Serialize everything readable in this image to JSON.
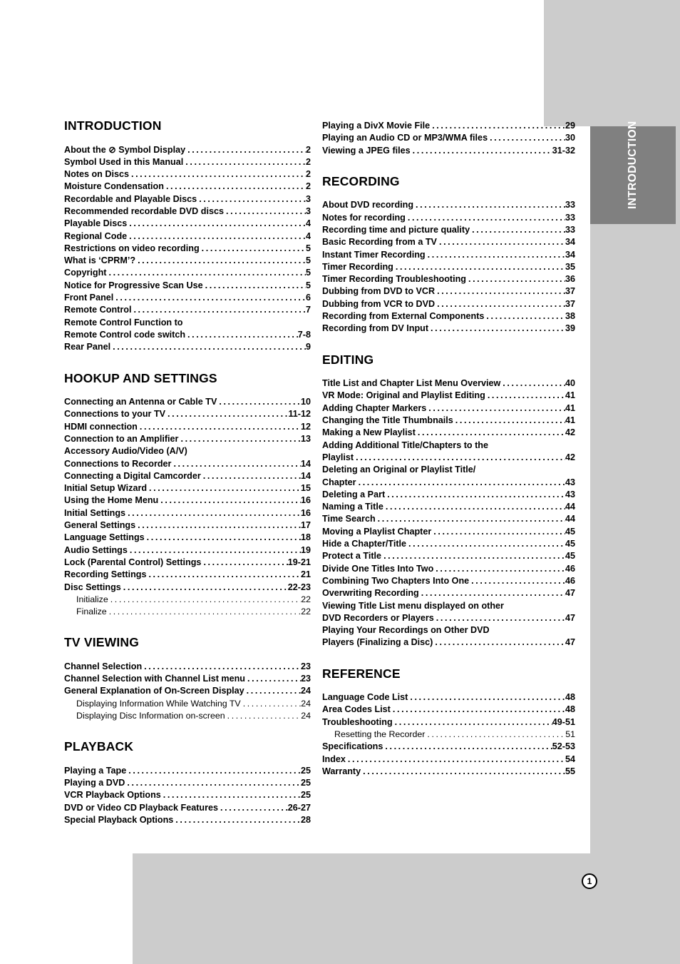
{
  "side_tab": {
    "label": "INTRODUCTION"
  },
  "page_number": "1",
  "columns": {
    "left": [
      {
        "title": "INTRODUCTION",
        "entries": [
          {
            "title": "About the ⊘ Symbol Display",
            "page": "2",
            "level": 1
          },
          {
            "title": "Symbol Used in this Manual",
            "page": "2",
            "level": 1
          },
          {
            "title": "Notes on Discs",
            "page": "2",
            "level": 1
          },
          {
            "title": "Moisture Condensation",
            "page": "2",
            "level": 1
          },
          {
            "title": "Recordable and Playable Discs",
            "page": "3",
            "level": 1
          },
          {
            "title": "Recommended recordable DVD discs",
            "page": "3",
            "level": 1
          },
          {
            "title": "Playable Discs",
            "page": "4",
            "level": 1
          },
          {
            "title": "Regional Code",
            "page": "4",
            "level": 1
          },
          {
            "title": "Restrictions on video recording",
            "page": "5",
            "level": 1
          },
          {
            "title": "What is ‘CPRM’?",
            "page": "5",
            "level": 1
          },
          {
            "title": "Copyright",
            "page": "5",
            "level": 1
          },
          {
            "title": "Notice for Progressive Scan Use",
            "page": "5",
            "level": 1
          },
          {
            "title": "Front Panel",
            "page": "6",
            "level": 1
          },
          {
            "title": "Remote Control",
            "page": "7",
            "level": 1
          },
          {
            "title": "Remote Control Function to",
            "page": "",
            "level": 1,
            "nopage": true
          },
          {
            "title": "Remote Control code switch",
            "page": "7-8",
            "level": 1
          },
          {
            "title": "Rear Panel",
            "page": "9",
            "level": 1
          }
        ]
      },
      {
        "title": "HOOKUP AND SETTINGS",
        "entries": [
          {
            "title": "Connecting an Antenna or Cable TV",
            "page": "10",
            "level": 1
          },
          {
            "title": "Connections to your TV",
            "page": "11-12",
            "level": 1
          },
          {
            "title": "HDMI connection",
            "page": "12",
            "level": 1
          },
          {
            "title": "Connection to an Amplifier",
            "page": "13",
            "level": 1
          },
          {
            "title": "Accessory Audio/Video (A/V)",
            "page": "",
            "level": 1,
            "nopage": true
          },
          {
            "title": "Connections to Recorder",
            "page": "14",
            "level": 1
          },
          {
            "title": "Connecting a Digital Camcorder",
            "page": "14",
            "level": 1
          },
          {
            "title": "Initial Setup Wizard",
            "page": "15",
            "level": 1
          },
          {
            "title": "Using the Home Menu",
            "page": "16",
            "level": 1
          },
          {
            "title": "Initial Settings",
            "page": "16",
            "level": 1
          },
          {
            "title": "General Settings",
            "page": "17",
            "level": 1
          },
          {
            "title": "Language Settings",
            "page": "18",
            "level": 1
          },
          {
            "title": "Audio Settings",
            "page": "19",
            "level": 1
          },
          {
            "title": "Lock (Parental Control) Settings",
            "page": "19-21",
            "level": 1
          },
          {
            "title": "Recording Settings",
            "page": "21",
            "level": 1
          },
          {
            "title": "Disc Settings",
            "page": "22-23",
            "level": 1
          },
          {
            "title": "Initialize",
            "page": "22",
            "level": 2
          },
          {
            "title": "Finalize",
            "page": "22",
            "level": 2
          }
        ]
      },
      {
        "title": "TV VIEWING",
        "entries": [
          {
            "title": "Channel Selection",
            "page": "23",
            "level": 1
          },
          {
            "title": "Channel Selection with Channel List menu",
            "page": "23",
            "level": 1
          },
          {
            "title": "General Explanation of On-Screen Display",
            "page": "24",
            "level": 1
          },
          {
            "title": "Displaying Information While Watching TV",
            "page": "24",
            "level": 2
          },
          {
            "title": "Displaying Disc Information on-screen",
            "page": "24",
            "level": 2
          }
        ]
      },
      {
        "title": "PLAYBACK",
        "entries": [
          {
            "title": "Playing a Tape",
            "page": "25",
            "level": 1
          },
          {
            "title": "Playing a DVD",
            "page": "25",
            "level": 1
          },
          {
            "title": "VCR Playback Options",
            "page": "25",
            "level": 1
          },
          {
            "title": "DVD or Video CD Playback Features",
            "page": "26-27",
            "level": 1
          },
          {
            "title": "Special Playback Options",
            "page": "28",
            "level": 1
          }
        ]
      }
    ],
    "right": [
      {
        "title": "",
        "continuation": true,
        "entries": [
          {
            "title": "Playing a DivX Movie File",
            "page": "29",
            "level": 1
          },
          {
            "title": "Playing an Audio CD or MP3/WMA files",
            "page": "30",
            "level": 1
          },
          {
            "title": "Viewing a JPEG files",
            "page": "31-32",
            "level": 1
          }
        ]
      },
      {
        "title": "RECORDING",
        "entries": [
          {
            "title": "About DVD recording",
            "page": "33",
            "level": 1
          },
          {
            "title": "Notes for recording",
            "page": "33",
            "level": 1
          },
          {
            "title": "Recording time and picture quality",
            "page": "33",
            "level": 1
          },
          {
            "title": "Basic Recording from a TV",
            "page": "34",
            "level": 1
          },
          {
            "title": "Instant Timer Recording",
            "page": "34",
            "level": 1
          },
          {
            "title": "Timer Recording",
            "page": "35",
            "level": 1
          },
          {
            "title": "Timer Recording Troubleshooting",
            "page": "36",
            "level": 1
          },
          {
            "title": "Dubbing from DVD to VCR",
            "page": "37",
            "level": 1
          },
          {
            "title": "Dubbing from VCR to DVD",
            "page": "37",
            "level": 1
          },
          {
            "title": "Recording from External Components",
            "page": "38",
            "level": 1
          },
          {
            "title": "Recording from DV Input",
            "page": "39",
            "level": 1
          }
        ]
      },
      {
        "title": "EDITING",
        "entries": [
          {
            "title": "Title List and Chapter List Menu Overview",
            "page": "40",
            "level": 1
          },
          {
            "title": "VR Mode: Original and Playlist Editing",
            "page": "41",
            "level": 1
          },
          {
            "title": "Adding Chapter Markers",
            "page": "41",
            "level": 1
          },
          {
            "title": "Changing the Title Thumbnails",
            "page": "41",
            "level": 1
          },
          {
            "title": "Making a New Playlist",
            "page": "42",
            "level": 1
          },
          {
            "title": "Adding Additional Title/Chapters to the",
            "page": "",
            "level": 1,
            "nopage": true
          },
          {
            "title": "Playlist",
            "page": "42",
            "level": 1
          },
          {
            "title": "Deleting an Original or Playlist Title/",
            "page": "",
            "level": 1,
            "nopage": true
          },
          {
            "title": "Chapter",
            "page": "43",
            "level": 1
          },
          {
            "title": "Deleting a Part",
            "page": "43",
            "level": 1
          },
          {
            "title": "Naming a Title",
            "page": "44",
            "level": 1
          },
          {
            "title": "Time Search",
            "page": "44",
            "level": 1
          },
          {
            "title": "Moving a Playlist Chapter",
            "page": "45",
            "level": 1
          },
          {
            "title": "Hide a Chapter/Title",
            "page": "45",
            "level": 1
          },
          {
            "title": "Protect a Title",
            "page": "45",
            "level": 1
          },
          {
            "title": "Divide One Titles Into Two",
            "page": "46",
            "level": 1
          },
          {
            "title": "Combining Two Chapters Into One",
            "page": "46",
            "level": 1
          },
          {
            "title": "Overwriting Recording",
            "page": "47",
            "level": 1
          },
          {
            "title": "Viewing Title List menu displayed on other",
            "page": "",
            "level": 1,
            "nopage": true
          },
          {
            "title": "DVD Recorders or Players",
            "page": "47",
            "level": 1
          },
          {
            "title": "Playing Your Recordings on Other DVD",
            "page": "",
            "level": 1,
            "nopage": true
          },
          {
            "title": "Players (Finalizing a Disc)",
            "page": "47",
            "level": 1
          }
        ]
      },
      {
        "title": "REFERENCE",
        "entries": [
          {
            "title": "Language Code List",
            "page": "48",
            "level": 1
          },
          {
            "title": "Area Codes List",
            "page": "48",
            "level": 1
          },
          {
            "title": "Troubleshooting",
            "page": "49-51",
            "level": 1
          },
          {
            "title": "Resetting the Recorder",
            "page": "51",
            "level": 2
          },
          {
            "title": "Specifications",
            "page": "52-53",
            "level": 1
          },
          {
            "title": "Index",
            "page": "54",
            "level": 1
          },
          {
            "title": "Warranty",
            "page": "55",
            "level": 1
          }
        ]
      }
    ]
  }
}
